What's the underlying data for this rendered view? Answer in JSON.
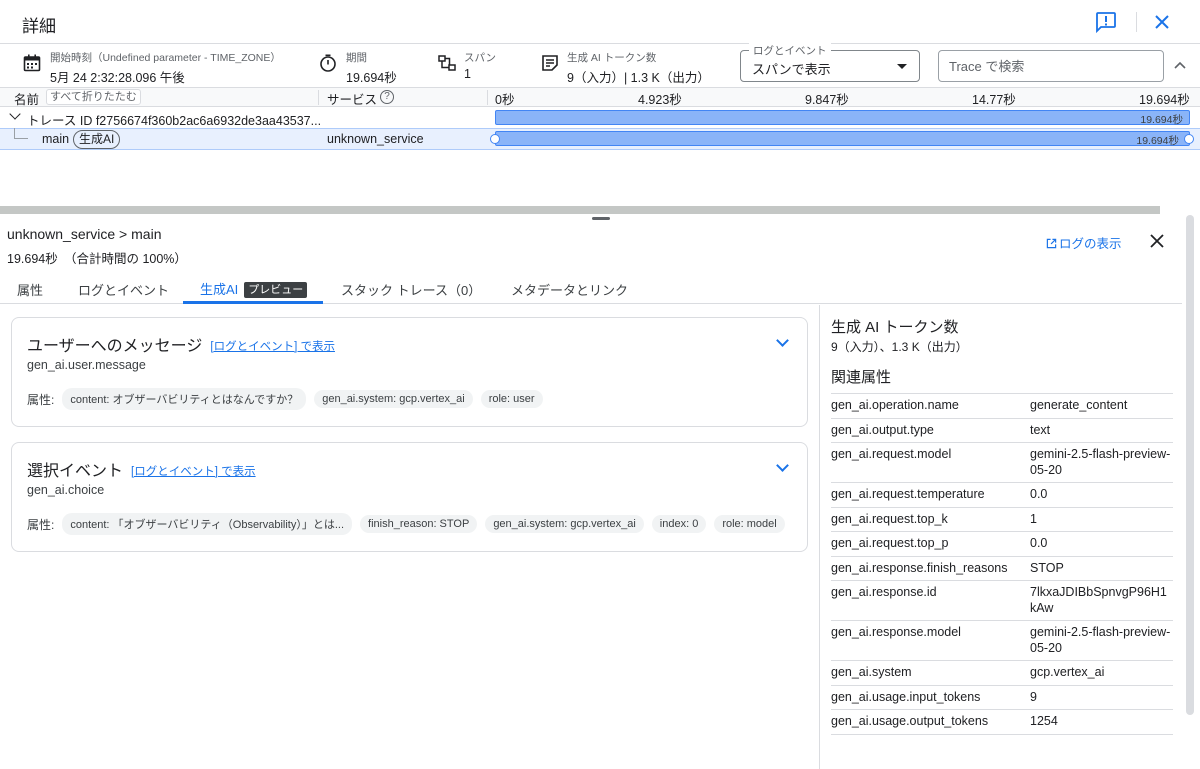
{
  "header": {
    "title": "詳細"
  },
  "summary": {
    "start_label": "開始時刻（Undefined parameter - TIME_ZONE）",
    "start_value": "5月 24 2:32:28.096 午後",
    "duration_label": "期間",
    "duration_value": "19.694秒",
    "spans_label": "スパン",
    "spans_value": "1",
    "tokens_label": "生成 AI トークン数",
    "tokens_value": "9（入力）| 1.3 K（出力）",
    "view_label": "ログとイベント",
    "view_value": "スパンで表示",
    "search_placeholder": "Trace で検索"
  },
  "table": {
    "col_name": "名前",
    "collapse_all": "すべて折りたたむ",
    "col_service": "サービス",
    "ticks": [
      "0秒",
      "4.923秒",
      "9.847秒",
      "14.77秒",
      "19.694秒"
    ],
    "trace_row": {
      "label": "トレース ID f2756674f360b2ac6a6932de3aa43537...",
      "bar_label": "19.694秒"
    },
    "span_row": {
      "name": "main",
      "chip": "生成AI",
      "service": "unknown_service",
      "bar_label": "19.694秒"
    }
  },
  "detail": {
    "breadcrumb_service": "unknown_service",
    "breadcrumb_sep": " > ",
    "breadcrumb_span": "main",
    "duration": "19.694秒　（合計時間の 100%）",
    "logs_link": "ログの表示",
    "tabs": [
      "属性",
      "ログとイベント",
      "生成AI",
      "スタック トレース（0）",
      "メタデータとリンク"
    ],
    "preview_badge": "プレビュー"
  },
  "cards": [
    {
      "title": "ユーザーへのメッセージ",
      "link": "[ログとイベント] で表示",
      "sub": "gen_ai.user.message",
      "attrs_label": "属性:",
      "attrs": [
        "content: オブザーバビリティとはなんですか？",
        "gen_ai.system: gcp.vertex_ai",
        "role: user"
      ]
    },
    {
      "title": "選択イベント",
      "link": "[ログとイベント] で表示",
      "sub": "gen_ai.choice",
      "attrs_label": "属性:",
      "attrs": [
        "content: 「オブザーバビリティ（Observability）」とは...",
        "finish_reason: STOP",
        "gen_ai.system: gcp.vertex_ai",
        "index: 0",
        "role: model"
      ]
    }
  ],
  "right": {
    "tokens_title": "生成 AI トークン数",
    "tokens_value": "9（入力）、1.3 K（出力）",
    "attrs_title": "関連属性",
    "rows": [
      {
        "k": "gen_ai.operation.name",
        "v": "generate_content"
      },
      {
        "k": "gen_ai.output.type",
        "v": "text"
      },
      {
        "k": "gen_ai.request.model",
        "v": "gemini-2.5-flash-preview-05-20"
      },
      {
        "k": "gen_ai.request.temperature",
        "v": "0.0"
      },
      {
        "k": "gen_ai.request.top_k",
        "v": "1"
      },
      {
        "k": "gen_ai.request.top_p",
        "v": "0.0"
      },
      {
        "k": "gen_ai.response.finish_reasons",
        "v": "STOP"
      },
      {
        "k": "gen_ai.response.id",
        "v": "7lkxaJDIBbSpnvgP96H1kAw"
      },
      {
        "k": "gen_ai.response.model",
        "v": "gemini-2.5-flash-preview-05-20"
      },
      {
        "k": "gen_ai.system",
        "v": "gcp.vertex_ai"
      },
      {
        "k": "gen_ai.usage.input_tokens",
        "v": "9"
      },
      {
        "k": "gen_ai.usage.output_tokens",
        "v": "1254"
      }
    ]
  },
  "colors": {
    "accent": "#1a73e8",
    "bar_fill": "#8ab4f8",
    "bar_border": "#4285f4",
    "selected_row": "#e8f0fe"
  }
}
